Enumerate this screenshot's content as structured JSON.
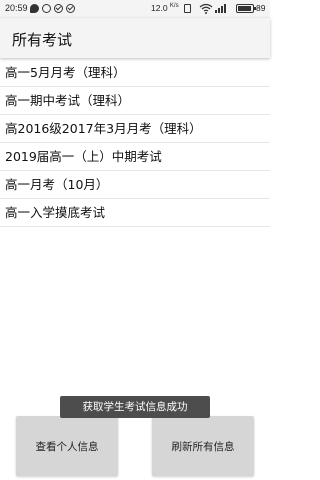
{
  "status_bar": {
    "time": "20:59",
    "network_speed": "12.0",
    "speed_unit": "K/s",
    "battery": "89",
    "left_icons": [
      "chat-icon",
      "message-icon",
      "check-circle-icon",
      "check-circle-icon"
    ],
    "right_icons": [
      "vibrate-icon",
      "wifi-icon",
      "signal-icon",
      "battery-icon"
    ]
  },
  "toolbar": {
    "title": "所有考试"
  },
  "exams": [
    "高一5月月考（理科）",
    "高一期中考试（理科）",
    "高2016级2017年3月月考（理科）",
    "2019届高一（上）中期考试",
    "高一月考（10月）",
    "高一入学摸底考试"
  ],
  "toast": {
    "message": "获取学生考试信息成功"
  },
  "buttons": {
    "view_personal_info": "查看个人信息",
    "refresh_all_info": "刷新所有信息"
  },
  "colors": {
    "background": "#ffffff",
    "toolbar": "#f4f4f4",
    "toast": "#4d4d4d",
    "button": "#d6d6d6"
  }
}
